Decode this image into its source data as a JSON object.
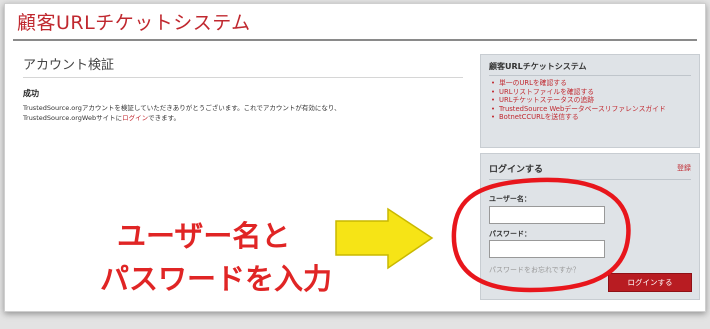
{
  "app": {
    "title": "顧客URLチケットシステム"
  },
  "main": {
    "section_title": "アカウント検証",
    "status": "成功",
    "message_line1": "TrustedSource.orgアカウントを検証していただきありがとうございます。これでアカウントが有効になり、",
    "message_line2_prefix": "TrustedSource.orgWebサイトに",
    "message_line2_link": "ログイン",
    "message_line2_suffix": "できます。"
  },
  "sidebar": {
    "title": "顧客URLチケットシステム",
    "links": [
      "単一のURLを確認する",
      "URLリストファイルを確認する",
      "URLチケットステータスの追跡",
      "TrustedSource Webデータベースリファレンスガイド",
      "BotnetCCURLを送信する"
    ]
  },
  "login": {
    "title": "ログインする",
    "register_label": "登録",
    "username_label": "ユーザー名：",
    "username_value": "",
    "password_label": "パスワード：",
    "password_value": "",
    "forgot_label": "パスワードをお忘れですか？",
    "submit_label": "ログインする"
  },
  "annotation": {
    "line1": "ユーザー名と",
    "line2": "パスワードを入力",
    "text_color": "#e02525",
    "arrow_color": "#f6e416",
    "circle_color": "#e8161c"
  },
  "colors": {
    "accent": "#c0282f",
    "button": "#b81c22",
    "panel": "#dfe3e7"
  }
}
